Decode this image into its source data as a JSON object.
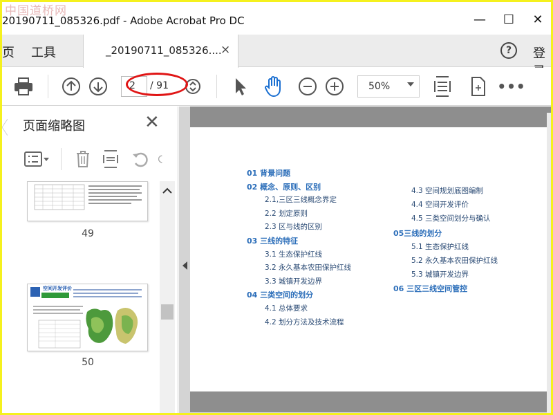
{
  "watermark": "中国道桥网",
  "window": {
    "title": "20190711_085326.pdf - Adobe Acrobat Pro DC",
    "minimize_glyph": "—",
    "maximize_glyph": "☐",
    "close_glyph": "✕"
  },
  "tabs": {
    "home_label": "页",
    "tools_label": "工具",
    "document_label": "_20190711_085326....",
    "document_close": "×",
    "help_glyph": "?",
    "signin_label": "登录"
  },
  "toolbar": {
    "current_page": "2",
    "total_pages": "/ 91",
    "zoom_value": "50%"
  },
  "thumbnails_panel": {
    "title": "页面缩略图",
    "close_glyph": "✕",
    "thumbnails": [
      {
        "page_number": "49"
      },
      {
        "page_number": "50",
        "heading_text": "空间开发评价"
      }
    ]
  },
  "document": {
    "toc_left": [
      {
        "text": "01  背景问题",
        "level": 1
      },
      {
        "text": "02  概念、原则、区别",
        "level": 1
      },
      {
        "text": "2.1,三区三线概念界定",
        "level": 2
      },
      {
        "text": "2.2  划定原则",
        "level": 2
      },
      {
        "text": "2.3  区与线的区别",
        "level": 2
      },
      {
        "text": "03  三线的特征",
        "level": 1
      },
      {
        "text": "3.1  生态保护红线",
        "level": 2
      },
      {
        "text": "3.2  永久基本农田保护红线",
        "level": 2
      },
      {
        "text": "3.3  城镇开发边界",
        "level": 2
      },
      {
        "text": "04  三类空间的划分",
        "level": 1
      },
      {
        "text": "4.1  总体要求",
        "level": 2
      },
      {
        "text": "4.2  划分方法及技术流程",
        "level": 2
      }
    ],
    "toc_right": [
      {
        "text": "4.3  空间规划底图编制",
        "level": 2
      },
      {
        "text": "4.4  空间开发评价",
        "level": 2
      },
      {
        "text": "4.5  三类空间划分与确认",
        "level": 2
      },
      {
        "text": "05三线的划分",
        "level": 1
      },
      {
        "text": "5.1  生态保护红线",
        "level": 2
      },
      {
        "text": "5.2  永久基本农田保护红线",
        "level": 2
      },
      {
        "text": "5.3  城镇开发边界",
        "level": 2
      },
      {
        "text": "06  三区三线空间管控",
        "level": 1
      }
    ]
  },
  "colors": {
    "accent_blue": "#2d6fba",
    "annotation_red": "#e01515",
    "screen_border": "#f5f11e"
  }
}
